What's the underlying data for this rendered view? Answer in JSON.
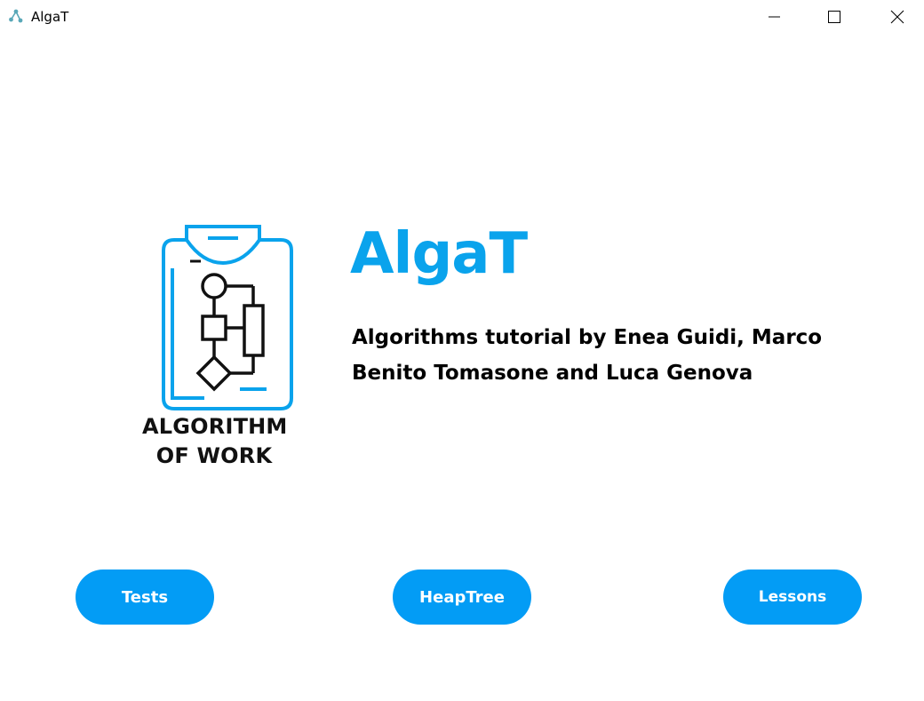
{
  "window": {
    "title": "AlgaT",
    "app_icon": "algat-app-icon",
    "controls": [
      "minimize-icon",
      "maximize-icon",
      "close-icon"
    ]
  },
  "logo": {
    "icon": "clipboard-flowchart-icon",
    "line1": "ALGORITHM",
    "line2": "OF WORK",
    "accent_color": "#0aa3ec"
  },
  "header": {
    "title": "AlgaT",
    "subtitle_line1": "Algorithms tutorial by Enea Guidi, Marco",
    "subtitle_line2": "Benito Tomasone and Luca Genova",
    "title_color": "#0aa3ec"
  },
  "buttons": {
    "tests": "Tests",
    "heaptree": "HeapTree",
    "lessons": "Lessons",
    "color": "#039cf5"
  }
}
